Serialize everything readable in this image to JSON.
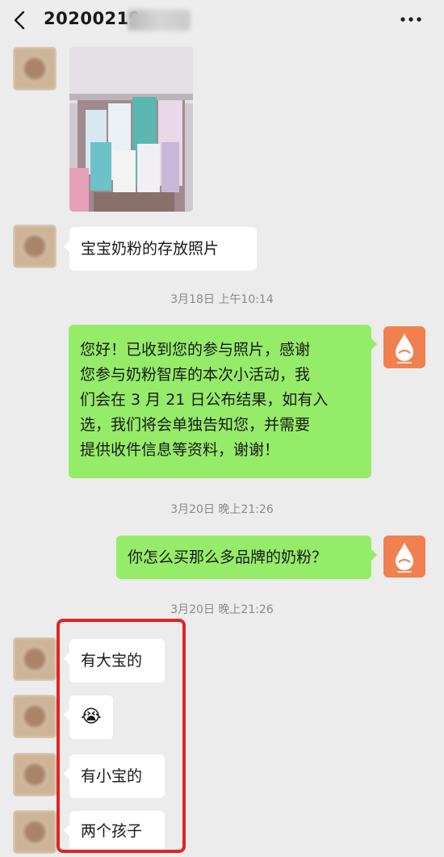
{
  "header": {
    "title": "20200219",
    "back_icon": "chevron-left-icon",
    "more_icon": "more-dots-icon"
  },
  "messages": [
    {
      "type": "image",
      "direction": "in",
      "description_icon": "photo-thumbnail"
    },
    {
      "type": "text",
      "direction": "in",
      "text": "宝宝奶粉的存放照片"
    },
    {
      "type": "time",
      "text": "3月18日 上午10:14"
    },
    {
      "type": "text",
      "direction": "out",
      "lines": [
        "您好！已收到您的参与照片，感谢",
        "您参与奶粉智库的本次小活动，我",
        "们会在 3 月 21 日公布结果，如有入",
        "选，我们将会单独告知您，并需要",
        "提供收件信息等资料，谢谢！"
      ]
    },
    {
      "type": "time",
      "text": "3月20日 晚上21:26"
    },
    {
      "type": "text",
      "direction": "out",
      "text": "你怎么买那么多品牌的奶粉？"
    },
    {
      "type": "time",
      "text": "3月20日 晚上21:26"
    },
    {
      "type": "text",
      "direction": "in",
      "text": "有大宝的"
    },
    {
      "type": "emoji",
      "direction": "in",
      "emoji": "😭",
      "emoji_icon": "crying-face-icon"
    },
    {
      "type": "text",
      "direction": "in",
      "text": "有小宝的"
    },
    {
      "type": "text",
      "direction": "in",
      "text": "两个孩子"
    }
  ],
  "colors": {
    "background": "#ececec",
    "incoming_bubble": "#ffffff",
    "outgoing_bubble": "#95ec69",
    "highlight": "#e3231f",
    "brand_logo": "#f08050"
  }
}
